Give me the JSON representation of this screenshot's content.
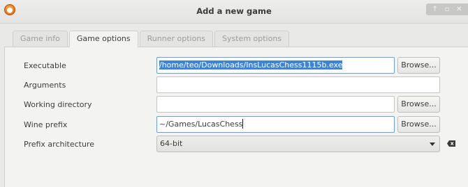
{
  "window": {
    "title": "Add a new game",
    "controls": [
      "↑",
      "▫",
      "✕"
    ]
  },
  "tabs": [
    {
      "label": "Game info",
      "active": false
    },
    {
      "label": "Game options",
      "active": true
    },
    {
      "label": "Runner options",
      "active": false
    },
    {
      "label": "System options",
      "active": false
    }
  ],
  "form": {
    "executable": {
      "label": "Executable",
      "value": "/home/teo/Downloads/InsLucasChess1115b.exe",
      "button": "Browse..."
    },
    "arguments": {
      "label": "Arguments",
      "value": ""
    },
    "working_directory": {
      "label": "Working directory",
      "value": "",
      "button": "Browse..."
    },
    "wine_prefix": {
      "label": "Wine prefix",
      "value": "~/Games/LucasChess",
      "button": "Browse..."
    },
    "prefix_architecture": {
      "label": "Prefix architecture",
      "value": "64-bit"
    }
  },
  "colors": {
    "selection": "#3d84d6",
    "focus_border": "#6a9fd8",
    "app_icon": "#e8741c"
  }
}
